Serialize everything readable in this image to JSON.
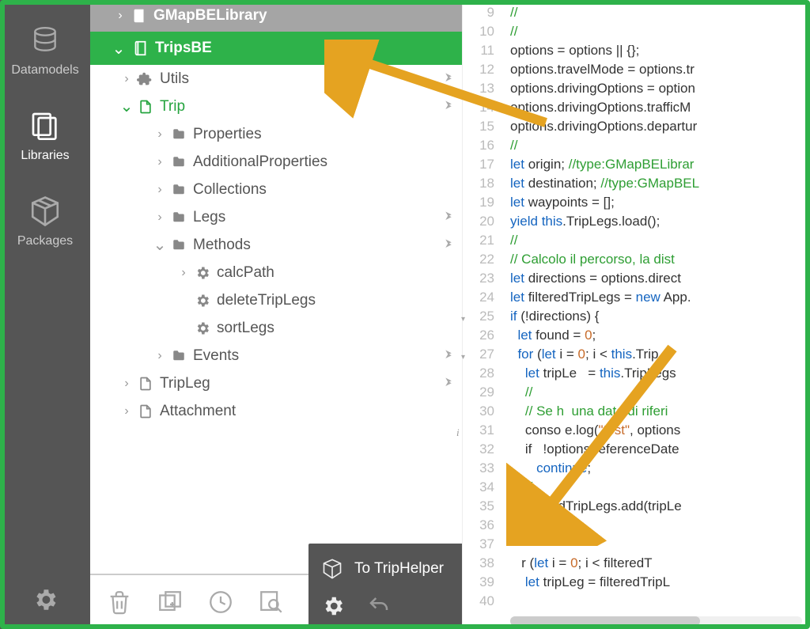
{
  "sidebar": {
    "items": [
      {
        "label": "Datamodels"
      },
      {
        "label": "Libraries"
      },
      {
        "label": "Packages"
      }
    ]
  },
  "tree": {
    "gmap_label": "GMapBELibrary",
    "tripsbe_label": "TripsBE",
    "utils_label": "Utils",
    "trip_label": "Trip",
    "properties_label": "Properties",
    "additional_label": "AdditionalProperties",
    "collections_label": "Collections",
    "legs_label": "Legs",
    "methods_label": "Methods",
    "calcpath_label": "calcPath",
    "deletetriplegs_label": "deleteTripLegs",
    "sortlegs_label": "sortLegs",
    "events_label": "Events",
    "tripleg_label": "TripLeg",
    "attachment_label": "Attachment"
  },
  "darkpanel": {
    "to_label": "To TripHelper"
  },
  "editor": {
    "lines": [
      {
        "n": 9,
        "html": "<span class='cm'>//</span>"
      },
      {
        "n": 10,
        "html": "<span class='cm'>//</span>"
      },
      {
        "n": 11,
        "html": "options = options || {};"
      },
      {
        "n": 12,
        "html": "options.travelMode = options.tr"
      },
      {
        "n": 13,
        "html": "options.drivingOptions = option"
      },
      {
        "n": 14,
        "html": "options.drivingOptions.trafficM"
      },
      {
        "n": 15,
        "html": "options.drivingOptions.departur"
      },
      {
        "n": 16,
        "html": "<span class='cm'>//</span>"
      },
      {
        "n": 17,
        "html": "<span class='kw'>let</span> origin; <span class='cm'>//type:GMapBELibrar</span>"
      },
      {
        "n": 18,
        "html": "<span class='kw'>let</span> destination; <span class='cm'>//type:GMapBEL</span>"
      },
      {
        "n": 19,
        "html": "<span class='kw'>let</span> waypoints = [];"
      },
      {
        "n": 20,
        "html": "<span class='kw'>yield</span> <span class='kw'>this</span>.TripLegs.load();"
      },
      {
        "n": 21,
        "html": "<span class='cm'>//</span>"
      },
      {
        "n": 22,
        "html": "<span class='cm'>// Calcolo il percorso, la dist</span>"
      },
      {
        "n": 23,
        "html": "<span class='kw'>let</span> directions = options.direct"
      },
      {
        "n": 24,
        "html": "<span class='kw'>let</span> filteredTripLegs = <span class='kw'>new</span> App."
      },
      {
        "n": 25,
        "fold": "▾",
        "html": "<span class='kw'>if</span> (!directions) {"
      },
      {
        "n": 26,
        "html": "  <span class='kw'>let</span> found = <span class='nm'>0</span>;"
      },
      {
        "n": 27,
        "fold": "▾",
        "html": "  <span class='kw'>for</span> (<span class='kw'>let</span> i = <span class='nm'>0</span>; i &lt; <span class='kw'>this</span>.Trip"
      },
      {
        "n": 28,
        "html": "    <span class='kw'>let</span> tripLe   = <span class='kw'>this</span>.TripLegs"
      },
      {
        "n": 29,
        "html": "    <span class='cm'>//</span>"
      },
      {
        "n": 30,
        "html": "    <span class='cm'>// Se h  una data di riferi</span>"
      },
      {
        "n": 31,
        "info": true,
        "html": "    conso e.log(<span class='st'>\"test\"</span>, options"
      },
      {
        "n": 32,
        "html": "    if   !options.referenceDate"
      },
      {
        "n": 33,
        "html": "       <span class='kw'>continue</span>;"
      },
      {
        "n": 34,
        "html": "    <span class='cm'>//</span>"
      },
      {
        "n": 35,
        "html": "    filteredTripLegs.add(tripLe"
      },
      {
        "n": 36,
        "html": ""
      },
      {
        "n": 37,
        "html": ""
      },
      {
        "n": 38,
        "html": "   r (<span class='kw'>let</span> i = <span class='nm'>0</span>; i &lt; filteredT"
      },
      {
        "n": 39,
        "html": "    <span class='kw'>let</span> tripLeg = filteredTripL"
      },
      {
        "n": 40,
        "html": ""
      }
    ]
  }
}
